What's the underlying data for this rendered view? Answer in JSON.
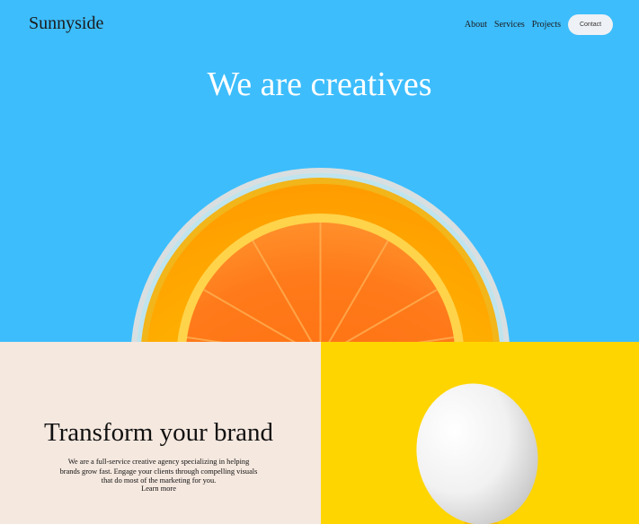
{
  "brand": {
    "logo": "Sunnyside"
  },
  "nav": {
    "items": [
      "About",
      "Services",
      "Projects"
    ],
    "contact_label": "Contact"
  },
  "hero": {
    "title": "We are creatives",
    "background": "#3dbdfc",
    "image": "orange-slice-in-glass"
  },
  "transform": {
    "title": "Transform your brand",
    "body": "We are a full-service creative agency specializing in helping brands grow fast. Engage your clients through compelling visuals that do most of the marketing for you.",
    "link": "Learn more",
    "background": "#f5e8df"
  },
  "egg_section": {
    "background": "#ffd500",
    "image": "white-egg"
  }
}
